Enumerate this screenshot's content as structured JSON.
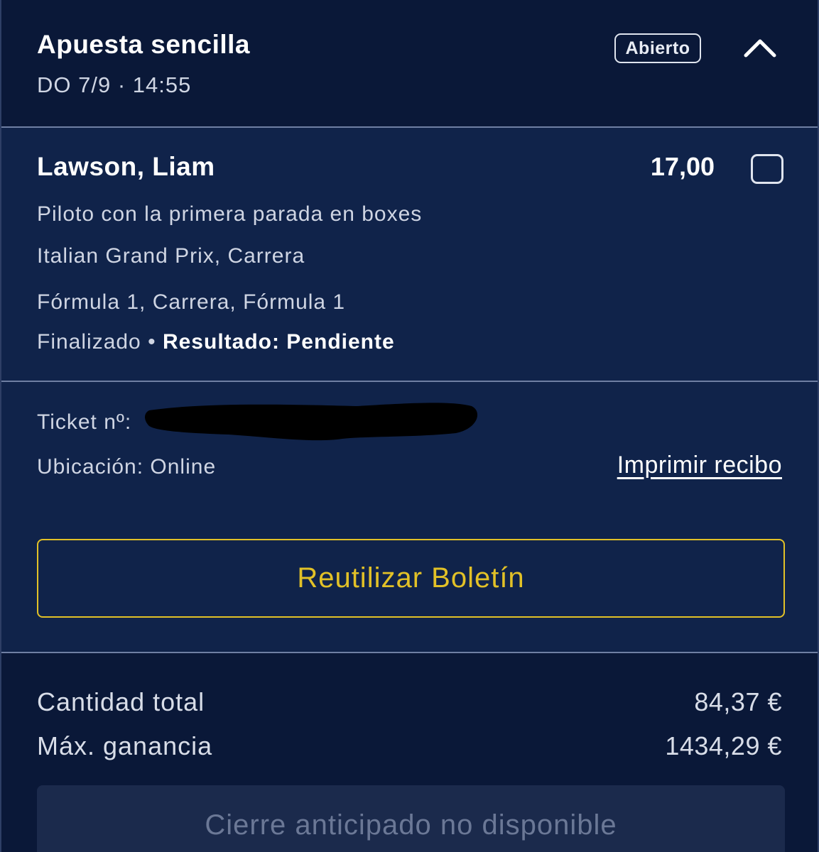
{
  "header": {
    "bet_type": "Apuesta sencilla",
    "date": "DO 7/9 · 14:55",
    "status": "Abierto",
    "collapse_icon": "chevron-up-icon"
  },
  "selection": {
    "name": "Lawson, Liam",
    "odds": "17,00",
    "market": "Piloto con la primera parada en boxes",
    "event": "Italian Grand Prix, Carrera",
    "competition": "Fórmula 1, Carrera, Fórmula 1",
    "event_status": "Finalizado",
    "separator": "•",
    "result_label": "Resultado: Pendiente"
  },
  "ticket": {
    "ticket_label": "Ticket nº:",
    "location": "Ubicación: Online",
    "print_label": "Imprimir recibo",
    "reuse_label": "Reutilizar Boletín"
  },
  "totals": {
    "total_label": "Cantidad total",
    "total_value": "84,37 €",
    "max_win_label": "Máx. ganancia",
    "max_win_value": "1434,29 €",
    "cashout_label": "Cierre anticipado no disponible"
  },
  "colors": {
    "accent_yellow": "#e2c127",
    "background_dark": "#0a1838",
    "background_panel": "#10234a",
    "divider": "#6f7fa3"
  }
}
